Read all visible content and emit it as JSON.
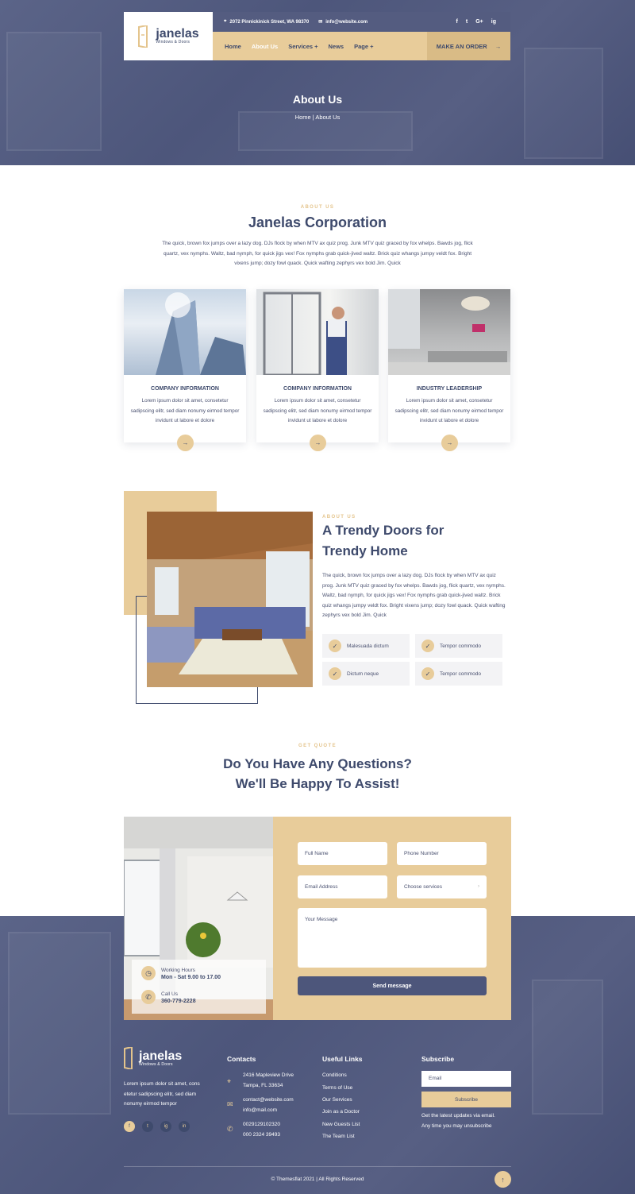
{
  "header": {
    "logo": {
      "name": "janelas",
      "tagline": "Windows & Doors"
    },
    "address": "2072 Pinnickinick Street, WA 98370",
    "email": "info@website.com",
    "social": [
      "f",
      "t",
      "G+",
      "ig"
    ],
    "nav": [
      {
        "label": "Home"
      },
      {
        "label": "About Us"
      },
      {
        "label": "Services +"
      },
      {
        "label": "News"
      },
      {
        "label": "Page +"
      }
    ],
    "order_label": "MAKE AN ORDER",
    "order_arrow": "→"
  },
  "hero": {
    "title": "About Us",
    "breadcrumb": "Home | About Us"
  },
  "about": {
    "eyebrow": "ABOUT US",
    "title": "Janelas Corporation",
    "text": "The quick, brown fox jumps over a lazy dog. DJs flock by when MTV ax quiz prog. Junk MTV quiz graced by fox whelps. Bawds jog, flick quartz, vex nymphs. Waltz, bad nymph, for quick jigs vex! Fox nymphs grab quick-jived waltz. Brick quiz whangs jumpy veldt fox. Bright vixens jump; dozy fowl quack. Quick wafting zephyrs vex bold Jim. Quick"
  },
  "cards": [
    {
      "title": "COMPANY INFORMATION",
      "text": "Lorem ipsum dolor sit amet, consetetur sadipscing elitr, sed diam nonumy eirmod tempor invidunt ut labore et dolore",
      "arrow": "→"
    },
    {
      "title": "COMPANY INFORMATION",
      "text": "Lorem ipsum dolor sit amet, consetetur sadipscing elitr, sed diam nonumy eirmod tempor invidunt ut labore et dolore",
      "arrow": "→"
    },
    {
      "title": "INDUSTRY LEADERSHIP",
      "text": "Lorem ipsum dolor sit amet, consetetur sadipscing elitr, sed diam nonumy eirmod tempor invidunt ut labore et dolore",
      "arrow": "→"
    }
  ],
  "trendy": {
    "eyebrow": "ABOUT US",
    "title_line1": "A Trendy Doors for",
    "title_line2": "Trendy Home",
    "text": "The quick, brown fox jumps over a lazy dog. DJs flock by when MTV ax quiz prog. Junk MTV quiz graced by fox whelps. Bawds jog, flick quartz, vex nymphs. Waltz, bad nymph, for quick jigs vex! Fox nymphs grab quick-jived waltz. Brick quiz whangs jumpy veldt fox. Bright vixens jump; dozy fowl quack. Quick wafting zephyrs vex bold Jim. Quick",
    "features": [
      "Malesuada dictum",
      "Tempor commodo",
      "Dictum neque",
      "Tempor commodo"
    ]
  },
  "quote": {
    "eyebrow": "GET QUOTE",
    "title_line1": "Do You Have Any Questions?",
    "title_line2": "We'll Be Happy To Assist!",
    "working_label": "Working Hours",
    "working_value": "Mon - Sat 9.00 to 17.00",
    "call_label": "Call Us",
    "call_value": "360-779-2228",
    "form": {
      "full_name": "Full Name",
      "phone": "Phone Number",
      "email": "Email Address",
      "services": "Choose services",
      "message": "Your Message",
      "submit": "Send message"
    }
  },
  "footer": {
    "logo": {
      "name": "janelas",
      "tagline": "Windows & Doors"
    },
    "about_text": "Lorem ipsum dolor sit amet, cons etetur sadipscing elitr, sed diam nonumy eirmod tempor",
    "social": [
      "f",
      "t",
      "ig",
      "in"
    ],
    "contacts_title": "Contacts",
    "address_1": "2416 Mapleview Drive",
    "address_2": "Tampa, FL 33634",
    "email_1": "contact@website.com",
    "email_2": "info@mail.com",
    "phone_1": "0029129102320",
    "phone_2": "000 2324 39493",
    "links_title": "Useful Links",
    "links": [
      "Conditions",
      "Terms of Use",
      "Our Services",
      "Join as a Doctor",
      "New Guests List",
      "The Team List"
    ],
    "subscribe_title": "Subscribe",
    "subscribe_placeholder": "Email",
    "subscribe_button": "Subscribe",
    "subscribe_note_1": "Get the latest updates via email.",
    "subscribe_note_2": "Any time you may unsubscribe",
    "copyright": "© Themesflat 2021 | All Rights Reserved",
    "back_to_top": "↑"
  },
  "colors": {
    "navy": "#3e4a6c",
    "beige": "#e8cc9a",
    "overlay": "#4d567b"
  }
}
